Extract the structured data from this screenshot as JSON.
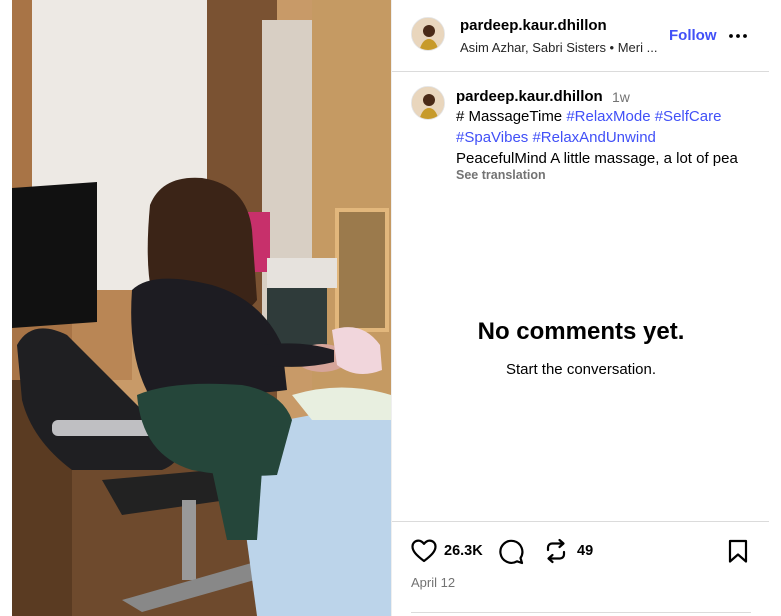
{
  "post": {
    "author": {
      "username": "pardeep.kaur.dhillon",
      "audio_label": "Asim Azhar, Sabri Sisters • Meri ...",
      "follow_label": "Follow"
    },
    "caption": {
      "username": "pardeep.kaur.dhillon",
      "time": "1w",
      "line1_text": "# MassageTime",
      "line1_tags": [
        "#RelaxMode",
        "#SelfCare"
      ],
      "line2_tags": [
        "#SpaVibes",
        "#RelaxAndUnwind"
      ],
      "line3_text": "PeacefulMind A little massage, a lot of pea",
      "see_translation": "See translation"
    },
    "comments": {
      "empty_title": "No comments yet.",
      "empty_subtitle": "Start the conversation."
    },
    "actions": {
      "likes": "26.3K",
      "reposts": "49",
      "icons": [
        "heart-icon",
        "comment-icon",
        "repost-icon",
        "bookmark-icon",
        "more-icon"
      ]
    },
    "date": "April 12"
  }
}
